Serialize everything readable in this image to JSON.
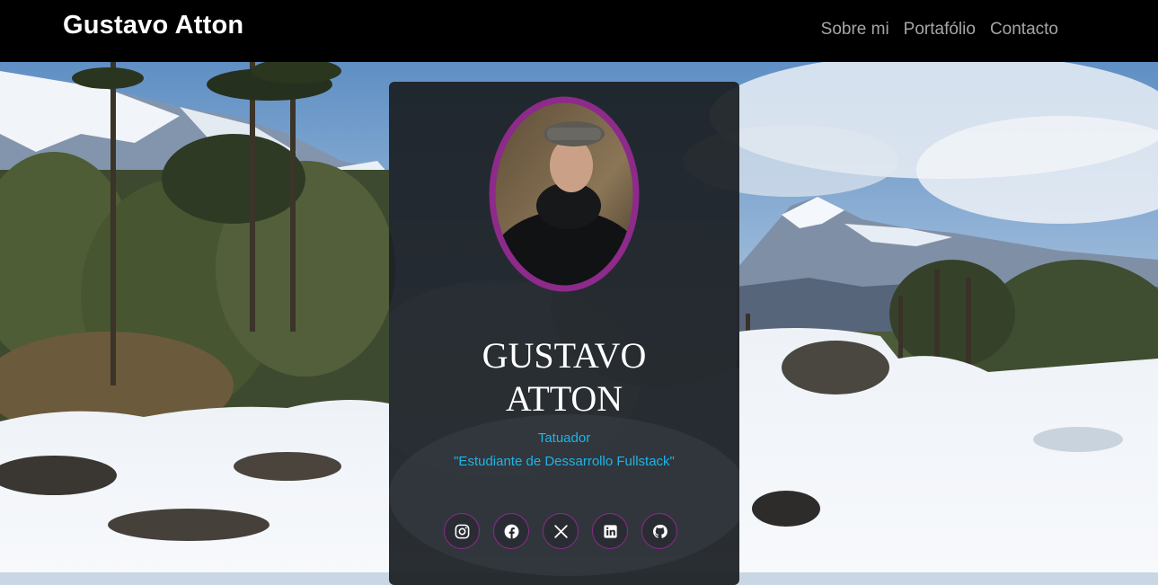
{
  "navbar": {
    "brand": "Gustavo Atton",
    "links": [
      {
        "label": "Sobre mi"
      },
      {
        "label": "Portafólio"
      },
      {
        "label": "Contacto"
      }
    ]
  },
  "profile": {
    "name_line1": "GUSTAVO",
    "name_line2": "ATTON",
    "role": "Tatuador",
    "tagline": "\"Estudiante de Dessarrollo Fullstack\"",
    "avatar_border_color": "#8d2a8a",
    "accent_color": "#1fb4e8"
  },
  "socials": [
    {
      "icon": "instagram-icon"
    },
    {
      "icon": "facebook-icon"
    },
    {
      "icon": "x-icon"
    },
    {
      "icon": "linkedin-icon"
    },
    {
      "icon": "github-icon"
    }
  ]
}
